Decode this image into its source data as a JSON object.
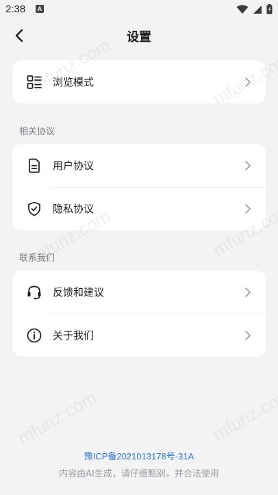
{
  "status_bar": {
    "time": "2:38",
    "notification_badge": "A",
    "icons": [
      "wifi-icon",
      "signal-icon",
      "battery-icon"
    ]
  },
  "header": {
    "title": "设置",
    "back_icon": "chevron-left-icon"
  },
  "group_display": {
    "items": [
      {
        "label": "浏览模式",
        "icon": "layout-list-icon"
      }
    ]
  },
  "group_agreements": {
    "title": "相关协议",
    "items": [
      {
        "label": "用户协议",
        "icon": "document-icon"
      },
      {
        "label": "隐私协议",
        "icon": "shield-check-icon"
      }
    ]
  },
  "group_contact": {
    "title": "联系我们",
    "items": [
      {
        "label": "反馈和建议",
        "icon": "headset-icon"
      },
      {
        "label": "关于我们",
        "icon": "info-icon"
      }
    ]
  },
  "footer": {
    "icp": "豫ICP备2021013178号-31A",
    "note": "内容由AI生成，请仔细甄别，并合法使用"
  },
  "watermark": {
    "text": "mfunz.com"
  },
  "colors": {
    "background": "#f3f3f5",
    "card": "#ffffff",
    "link": "#2d76c7",
    "muted": "#7a7a7e"
  }
}
